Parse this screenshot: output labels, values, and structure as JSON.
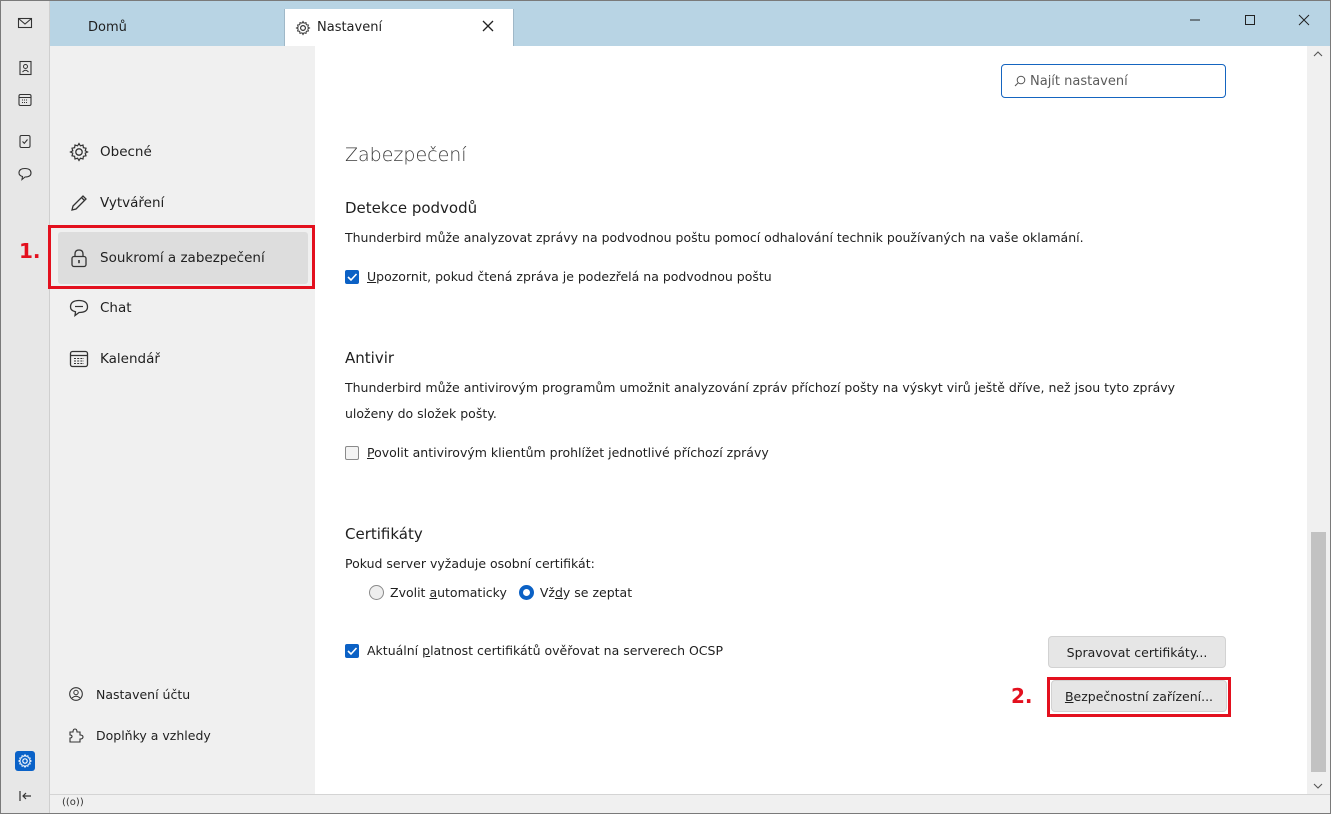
{
  "tabs": [
    {
      "label": "Domů"
    },
    {
      "label": "Nastavení"
    }
  ],
  "search": {
    "placeholder": "Najít nastavení"
  },
  "nav": {
    "items": [
      {
        "label": "Obecné",
        "icon": "gear-icon"
      },
      {
        "label": "Vytváření",
        "icon": "pencil-icon"
      },
      {
        "label": "Soukromí a zabezpečení",
        "icon": "lock-icon",
        "selected": true
      },
      {
        "label": "Chat",
        "icon": "chat-icon"
      },
      {
        "label": "Kalendář",
        "icon": "calendar-icon"
      }
    ],
    "bottom": [
      {
        "label": "Nastavení účtu",
        "icon": "account-icon"
      },
      {
        "label": "Doplňky a vzhledy",
        "icon": "puzzle-icon"
      }
    ]
  },
  "annotations": {
    "step1": "1.",
    "step2": "2."
  },
  "content": {
    "title": "Zabezpečení",
    "fraud": {
      "heading": "Detekce podvodů",
      "description": "Thunderbird může analyzovat zprávy na podvodnou poštu pomocí odhalování technik používaných na vaše oklamání.",
      "checkbox_first": "U",
      "checkbox_rest": "pozornit, pokud čtená zpráva je podezřelá na podvodnou poštu",
      "checked": true
    },
    "antivirus": {
      "heading": "Antivir",
      "description": "Thunderbird může antivirovým programům umožnit analyzování zpráv příchozí pošty na výskyt virů ještě dříve, než jsou tyto zprávy uloženy do složek pošty.",
      "checkbox_first": "P",
      "checkbox_rest": "ovolit antivirovým klientům prohlížet jednotlivé příchozí zprávy",
      "checked": false
    },
    "certificates": {
      "heading": "Certifikáty",
      "description": "Pokud server vyžaduje osobní certifikát:",
      "radio_auto_a": "Zvolit ",
      "radio_auto_u": "a",
      "radio_auto_b": "utomaticky",
      "radio_ask_a": "Vž",
      "radio_ask_u": "d",
      "radio_ask_b": "y se zeptat",
      "selected": "ask",
      "ocsp_a": "Aktuální ",
      "ocsp_u": "p",
      "ocsp_b": "latnost certifikátů ověřovat na serverech OCSP",
      "ocsp_checked": true,
      "manage_button": "Spravovat certifikáty...",
      "devices_button_u": "B",
      "devices_button_rest": "ezpečnostní zařízení..."
    }
  },
  "status": {
    "icon": "radio-waves-icon",
    "text": "((o))"
  },
  "colors": {
    "accent": "#0b61c5",
    "titlebar": "#b8d4e4",
    "highlight": "#e3101e"
  }
}
